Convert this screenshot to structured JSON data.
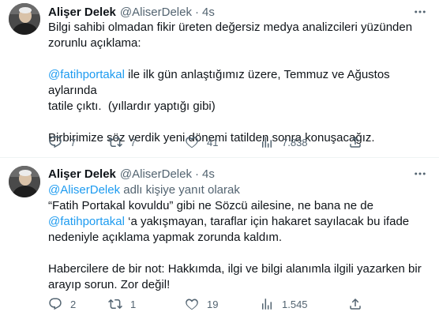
{
  "tweets": [
    {
      "author_name": "Alişer Delek",
      "author_handle": "@AliserDelek",
      "separator": "·",
      "time": "4s",
      "line1": "Bilgi sahibi olmadan fikir üreten değersiz medya analizcileri yüzünden",
      "line2": "zorunlu açıklama:",
      "line3_mention": "@fatihportakal",
      "line3_rest": " ile ilk gün anlaştığımız üzere, Temmuz ve Ağustos aylarında",
      "line4": "tatile çıktı.  (yıllardır yaptığı gibi)",
      "line5": "Birbirimize söz verdik yeni dönemi tatilden sonra konuşacağız.",
      "replies": "7",
      "retweets": "7",
      "likes": "41",
      "views": "7.838"
    },
    {
      "author_name": "Alişer Delek",
      "author_handle": "@AliserDelek",
      "separator": "·",
      "time": "4s",
      "reply_mention": "@AliserDelek",
      "reply_rest": " adlı kişiye yanıt olarak",
      "line1": "“Fatih Portakal kovuldu” gibi ne Sözcü ailesine, ne bana ne de",
      "line2_mention": "@fatihportakal",
      "line2_rest": " ‘a yakışmayan, taraflar için hakaret sayılacak bu ifade",
      "line3": "nedeniyle açıklama yapmak zorunda kaldım.",
      "line4": "Habercilere de bir not: Hakkımda, ilgi ve bilgi alanımla ilgili yazarken bir",
      "line5": "arayıp sorun. Zor değil!",
      "replies": "2",
      "retweets": "1",
      "likes": "19",
      "views": "1.545"
    }
  ],
  "colors": {
    "text": "#0f1419",
    "secondary": "#536471",
    "link": "#1d9bf0",
    "divider": "#eff3f4"
  },
  "icons": [
    "more-icon",
    "reply-icon",
    "retweet-icon",
    "like-icon",
    "views-icon",
    "share-icon"
  ]
}
